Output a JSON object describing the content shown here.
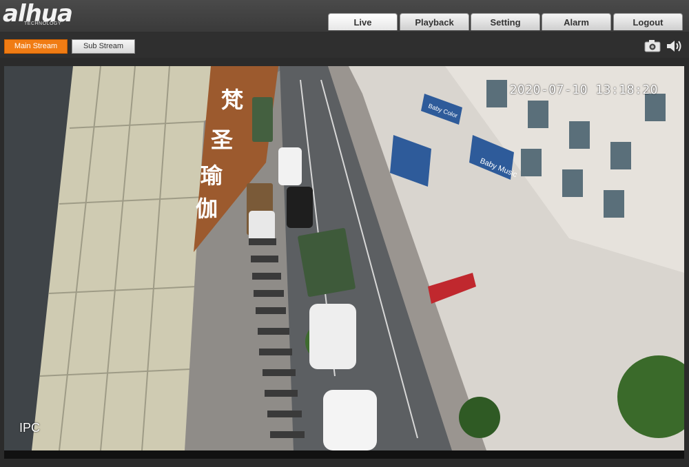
{
  "brand": {
    "logo": "alhua",
    "tagline": "TECHNOLOGY"
  },
  "nav": {
    "tabs": [
      "Live",
      "Playback",
      "Setting",
      "Alarm",
      "Logout"
    ],
    "active": "Live"
  },
  "toolbar": {
    "main_stream": "Main Stream",
    "sub_stream": "Sub Stream",
    "icons": [
      "snapshot-icon",
      "audio-icon"
    ]
  },
  "video": {
    "timestamp": "2020-07-10 13:18:20",
    "channel": "IPC",
    "signs": {
      "vertical": [
        "梵",
        "圣",
        "瑜",
        "伽"
      ],
      "shop1": "Baby Music",
      "shop2": "Baby Color"
    }
  },
  "colors": {
    "accent": "#f07c14",
    "header": "#404040"
  }
}
